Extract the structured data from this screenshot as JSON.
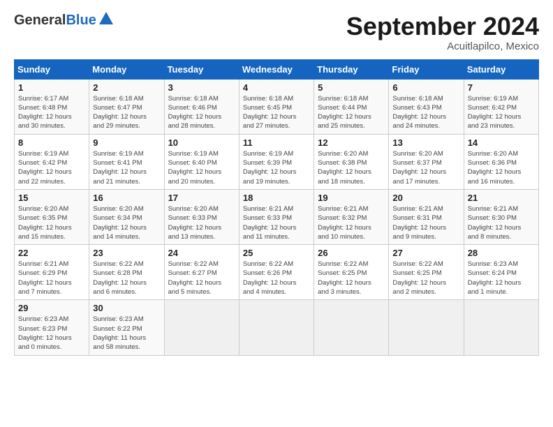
{
  "app": {
    "logo_general": "General",
    "logo_blue": "Blue"
  },
  "header": {
    "month": "September 2024",
    "location": "Acuitlapilco, Mexico"
  },
  "days_of_week": [
    "Sunday",
    "Monday",
    "Tuesday",
    "Wednesday",
    "Thursday",
    "Friday",
    "Saturday"
  ],
  "weeks": [
    [
      {
        "day": "1",
        "sunrise": "Sunrise: 6:17 AM",
        "sunset": "Sunset: 6:48 PM",
        "daylight": "Daylight: 12 hours and 30 minutes."
      },
      {
        "day": "2",
        "sunrise": "Sunrise: 6:18 AM",
        "sunset": "Sunset: 6:47 PM",
        "daylight": "Daylight: 12 hours and 29 minutes."
      },
      {
        "day": "3",
        "sunrise": "Sunrise: 6:18 AM",
        "sunset": "Sunset: 6:46 PM",
        "daylight": "Daylight: 12 hours and 28 minutes."
      },
      {
        "day": "4",
        "sunrise": "Sunrise: 6:18 AM",
        "sunset": "Sunset: 6:45 PM",
        "daylight": "Daylight: 12 hours and 27 minutes."
      },
      {
        "day": "5",
        "sunrise": "Sunrise: 6:18 AM",
        "sunset": "Sunset: 6:44 PM",
        "daylight": "Daylight: 12 hours and 25 minutes."
      },
      {
        "day": "6",
        "sunrise": "Sunrise: 6:18 AM",
        "sunset": "Sunset: 6:43 PM",
        "daylight": "Daylight: 12 hours and 24 minutes."
      },
      {
        "day": "7",
        "sunrise": "Sunrise: 6:19 AM",
        "sunset": "Sunset: 6:42 PM",
        "daylight": "Daylight: 12 hours and 23 minutes."
      }
    ],
    [
      {
        "day": "8",
        "sunrise": "Sunrise: 6:19 AM",
        "sunset": "Sunset: 6:42 PM",
        "daylight": "Daylight: 12 hours and 22 minutes."
      },
      {
        "day": "9",
        "sunrise": "Sunrise: 6:19 AM",
        "sunset": "Sunset: 6:41 PM",
        "daylight": "Daylight: 12 hours and 21 minutes."
      },
      {
        "day": "10",
        "sunrise": "Sunrise: 6:19 AM",
        "sunset": "Sunset: 6:40 PM",
        "daylight": "Daylight: 12 hours and 20 minutes."
      },
      {
        "day": "11",
        "sunrise": "Sunrise: 6:19 AM",
        "sunset": "Sunset: 6:39 PM",
        "daylight": "Daylight: 12 hours and 19 minutes."
      },
      {
        "day": "12",
        "sunrise": "Sunrise: 6:20 AM",
        "sunset": "Sunset: 6:38 PM",
        "daylight": "Daylight: 12 hours and 18 minutes."
      },
      {
        "day": "13",
        "sunrise": "Sunrise: 6:20 AM",
        "sunset": "Sunset: 6:37 PM",
        "daylight": "Daylight: 12 hours and 17 minutes."
      },
      {
        "day": "14",
        "sunrise": "Sunrise: 6:20 AM",
        "sunset": "Sunset: 6:36 PM",
        "daylight": "Daylight: 12 hours and 16 minutes."
      }
    ],
    [
      {
        "day": "15",
        "sunrise": "Sunrise: 6:20 AM",
        "sunset": "Sunset: 6:35 PM",
        "daylight": "Daylight: 12 hours and 15 minutes."
      },
      {
        "day": "16",
        "sunrise": "Sunrise: 6:20 AM",
        "sunset": "Sunset: 6:34 PM",
        "daylight": "Daylight: 12 hours and 14 minutes."
      },
      {
        "day": "17",
        "sunrise": "Sunrise: 6:20 AM",
        "sunset": "Sunset: 6:33 PM",
        "daylight": "Daylight: 12 hours and 13 minutes."
      },
      {
        "day": "18",
        "sunrise": "Sunrise: 6:21 AM",
        "sunset": "Sunset: 6:33 PM",
        "daylight": "Daylight: 12 hours and 11 minutes."
      },
      {
        "day": "19",
        "sunrise": "Sunrise: 6:21 AM",
        "sunset": "Sunset: 6:32 PM",
        "daylight": "Daylight: 12 hours and 10 minutes."
      },
      {
        "day": "20",
        "sunrise": "Sunrise: 6:21 AM",
        "sunset": "Sunset: 6:31 PM",
        "daylight": "Daylight: 12 hours and 9 minutes."
      },
      {
        "day": "21",
        "sunrise": "Sunrise: 6:21 AM",
        "sunset": "Sunset: 6:30 PM",
        "daylight": "Daylight: 12 hours and 8 minutes."
      }
    ],
    [
      {
        "day": "22",
        "sunrise": "Sunrise: 6:21 AM",
        "sunset": "Sunset: 6:29 PM",
        "daylight": "Daylight: 12 hours and 7 minutes."
      },
      {
        "day": "23",
        "sunrise": "Sunrise: 6:22 AM",
        "sunset": "Sunset: 6:28 PM",
        "daylight": "Daylight: 12 hours and 6 minutes."
      },
      {
        "day": "24",
        "sunrise": "Sunrise: 6:22 AM",
        "sunset": "Sunset: 6:27 PM",
        "daylight": "Daylight: 12 hours and 5 minutes."
      },
      {
        "day": "25",
        "sunrise": "Sunrise: 6:22 AM",
        "sunset": "Sunset: 6:26 PM",
        "daylight": "Daylight: 12 hours and 4 minutes."
      },
      {
        "day": "26",
        "sunrise": "Sunrise: 6:22 AM",
        "sunset": "Sunset: 6:25 PM",
        "daylight": "Daylight: 12 hours and 3 minutes."
      },
      {
        "day": "27",
        "sunrise": "Sunrise: 6:22 AM",
        "sunset": "Sunset: 6:25 PM",
        "daylight": "Daylight: 12 hours and 2 minutes."
      },
      {
        "day": "28",
        "sunrise": "Sunrise: 6:23 AM",
        "sunset": "Sunset: 6:24 PM",
        "daylight": "Daylight: 12 hours and 1 minute."
      }
    ],
    [
      {
        "day": "29",
        "sunrise": "Sunrise: 6:23 AM",
        "sunset": "Sunset: 6:23 PM",
        "daylight": "Daylight: 12 hours and 0 minutes."
      },
      {
        "day": "30",
        "sunrise": "Sunrise: 6:23 AM",
        "sunset": "Sunset: 6:22 PM",
        "daylight": "Daylight: 11 hours and 58 minutes."
      },
      {
        "day": "",
        "sunrise": "",
        "sunset": "",
        "daylight": ""
      },
      {
        "day": "",
        "sunrise": "",
        "sunset": "",
        "daylight": ""
      },
      {
        "day": "",
        "sunrise": "",
        "sunset": "",
        "daylight": ""
      },
      {
        "day": "",
        "sunrise": "",
        "sunset": "",
        "daylight": ""
      },
      {
        "day": "",
        "sunrise": "",
        "sunset": "",
        "daylight": ""
      }
    ]
  ]
}
